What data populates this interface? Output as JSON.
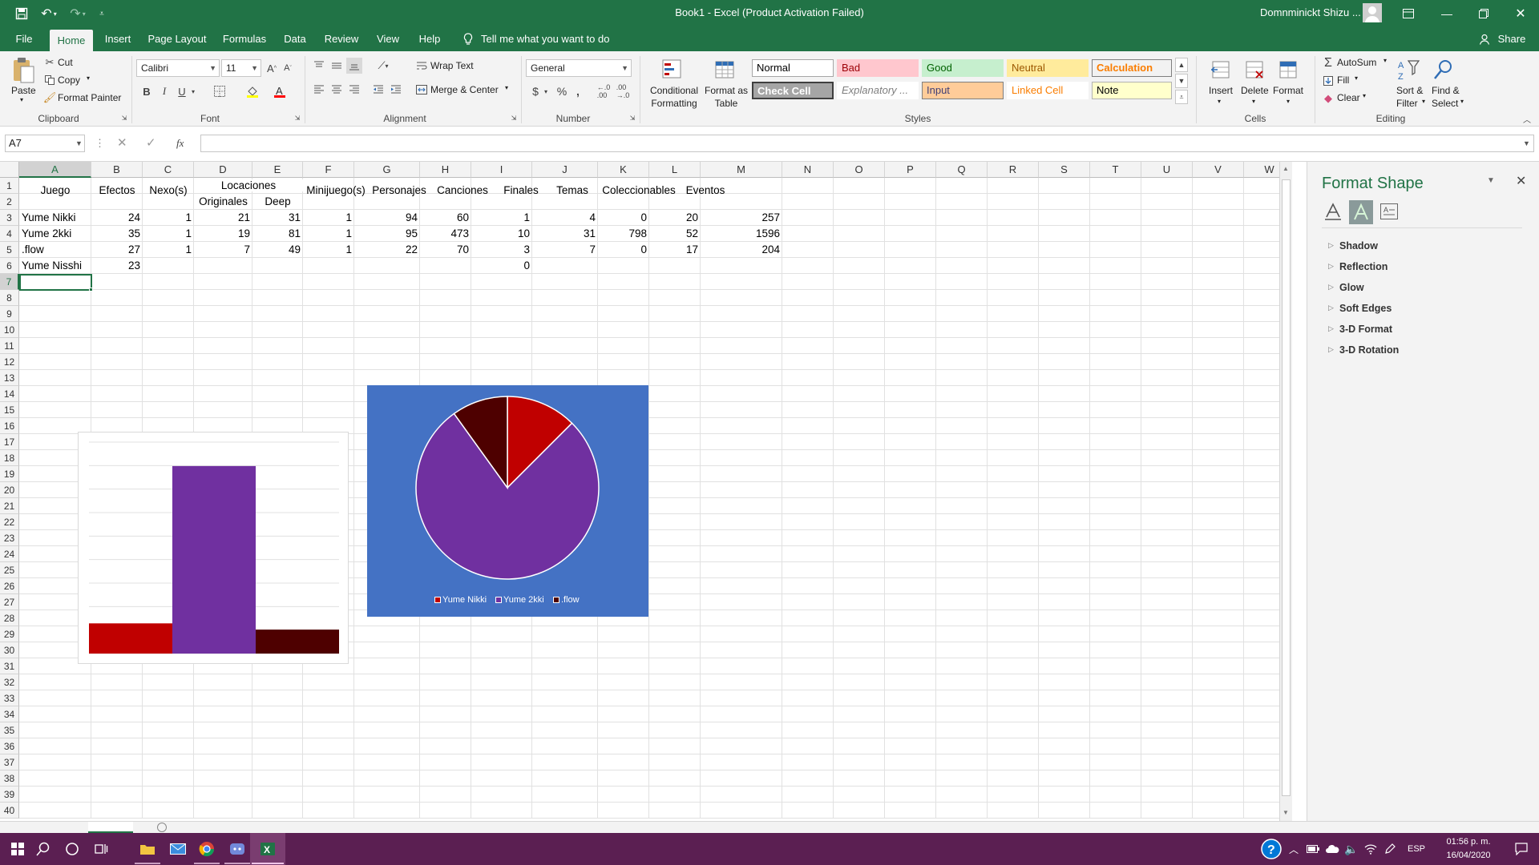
{
  "window": {
    "doc_title": "Book1 - Excel (Product Activation Failed)",
    "user": "Domnminickt Shizu ...",
    "share": "Share"
  },
  "tabs": [
    "File",
    "Home",
    "Insert",
    "Page Layout",
    "Formulas",
    "Data",
    "Review",
    "View",
    "Help"
  ],
  "tell_me": "Tell me what you want to do",
  "ribbon": {
    "clipboard": {
      "paste": "Paste",
      "cut": "Cut",
      "copy": "Copy",
      "format_painter": "Format Painter",
      "label": "Clipboard"
    },
    "font": {
      "name": "Calibri",
      "size": "11",
      "label": "Font",
      "bold": "B",
      "italic": "I",
      "underline": "U"
    },
    "alignment": {
      "wrap_text": "Wrap Text",
      "merge_center": "Merge & Center",
      "label": "Alignment"
    },
    "number": {
      "format": "General",
      "currency": "$",
      "percent": "%",
      "comma": ",",
      "label": "Number"
    },
    "styles": {
      "conditional": "Conditional",
      "conditional2": "Formatting",
      "format_table": "Format as",
      "format_table2": "Table",
      "cells": [
        {
          "name": "Normal",
          "bg": "#ffffff",
          "fg": "#000000",
          "border": "#a6a6a6"
        },
        {
          "name": "Bad",
          "bg": "#ffc7ce",
          "fg": "#9c0006",
          "border": "#ffc7ce"
        },
        {
          "name": "Good",
          "bg": "#c6efce",
          "fg": "#006100",
          "border": "#c6efce"
        },
        {
          "name": "Neutral",
          "bg": "#ffeb9c",
          "fg": "#9c5700",
          "border": "#ffeb9c"
        },
        {
          "name": "Calculation",
          "bg": "#f2f2f2",
          "fg": "#fa7d00",
          "border": "#7f7f7f"
        },
        {
          "name": "Check Cell",
          "bg": "#a5a5a5",
          "fg": "#ffffff",
          "border": "#3f3f3f"
        },
        {
          "name": "Explanatory ...",
          "bg": "#ffffff",
          "fg": "#7f7f7f",
          "border": "#ffffff"
        },
        {
          "name": "Input",
          "bg": "#ffcc99",
          "fg": "#3f3f76",
          "border": "#7f7f7f"
        },
        {
          "name": "Linked Cell",
          "bg": "#ffffff",
          "fg": "#fa7d00",
          "border": "#ffffff"
        },
        {
          "name": "Note",
          "bg": "#ffffcc",
          "fg": "#000000",
          "border": "#b2b2b2"
        }
      ],
      "label": "Styles"
    },
    "cells": {
      "insert": "Insert",
      "delete": "Delete",
      "format": "Format",
      "label": "Cells"
    },
    "editing": {
      "autosum": "AutoSum",
      "fill": "Fill",
      "clear": "Clear",
      "sort": "Sort &",
      "sort2": "Filter",
      "find": "Find &",
      "find2": "Select",
      "label": "Editing"
    }
  },
  "formula_bar": {
    "name_box": "A7",
    "fx": "fx",
    "formula": ""
  },
  "sheet": {
    "columns": [
      "A",
      "B",
      "C",
      "D",
      "E",
      "F",
      "G",
      "H",
      "I",
      "J",
      "K",
      "L",
      "M",
      "N",
      "O",
      "P",
      "Q",
      "R",
      "S",
      "T",
      "U",
      "V",
      "W"
    ],
    "rows": [
      "1",
      "2",
      "3",
      "4",
      "5",
      "6",
      "7",
      "8",
      "9",
      "10",
      "11",
      "12",
      "13",
      "14",
      "15",
      "16",
      "17",
      "18",
      "19",
      "20",
      "21",
      "22",
      "23",
      "24",
      "25",
      "26",
      "27",
      "28",
      "29",
      "30",
      "31",
      "32",
      "33",
      "34",
      "35",
      "36",
      "37",
      "38",
      "39",
      "40"
    ],
    "headers": {
      "juego": "Juego",
      "efectos": "Efectos",
      "nexos": "Nexo(s)",
      "locaciones": "Locaciones",
      "originales": "Originales",
      "deep": "Deep",
      "minijuegos": "Minijuego(s)",
      "personajes": "Personajes",
      "canciones": "Canciones",
      "finales": "Finales",
      "temas": "Temas",
      "coleccionables": "Coleccionables",
      "eventos": "Eventos"
    },
    "data_rows": [
      {
        "a": "Yume Nikki",
        "b": "24",
        "c": "1",
        "d": "21",
        "e": "31",
        "f": "1",
        "g": "94",
        "h": "60",
        "i": "1",
        "j": "4",
        "k": "0",
        "l": "20",
        "m": "257"
      },
      {
        "a": "Yume 2kki",
        "b": "35",
        "c": "1",
        "d": "19",
        "e": "81",
        "f": "1",
        "g": "95",
        "h": "473",
        "i": "10",
        "j": "31",
        "k": "798",
        "l": "52",
        "m": "1596"
      },
      {
        "a": ".flow",
        "b": "27",
        "c": "1",
        "d": "7",
        "e": "49",
        "f": "1",
        "g": "22",
        "h": "70",
        "i": "3",
        "j": "7",
        "k": "0",
        "l": "17",
        "m": "204"
      },
      {
        "a": "Yume Nisshi",
        "b": "23",
        "c": "",
        "d": "",
        "e": "",
        "f": "",
        "g": "",
        "h": "",
        "i": "0",
        "j": "",
        "k": "",
        "l": "",
        "m": ""
      }
    ]
  },
  "chart_data": [
    {
      "type": "bar",
      "categories": [
        "Yume Nikki",
        "Yume 2kki",
        ".flow"
      ],
      "values": [
        257,
        1596,
        204
      ],
      "colors": [
        "#c00000",
        "#7030a0",
        "#4e0000"
      ],
      "ylim": [
        0,
        1800
      ],
      "grid": true
    },
    {
      "type": "pie",
      "categories": [
        "Yume Nikki",
        "Yume 2kki",
        ".flow"
      ],
      "values": [
        257,
        1596,
        204
      ],
      "colors": [
        "#c00000",
        "#7030a0",
        "#4e0000"
      ],
      "legend": "bottom",
      "background": "#4472c4"
    }
  ],
  "legend_labels": [
    "Yume Nikki",
    "Yume 2kki",
    ".flow"
  ],
  "format_panel": {
    "title": "Format Shape",
    "sections": [
      "Shadow",
      "Reflection",
      "Glow",
      "Soft Edges",
      "3-D Format",
      "3-D Rotation"
    ]
  },
  "taskbar": {
    "lang": "ESP",
    "time": "01:56 p. m.",
    "date": "16/04/2020"
  }
}
